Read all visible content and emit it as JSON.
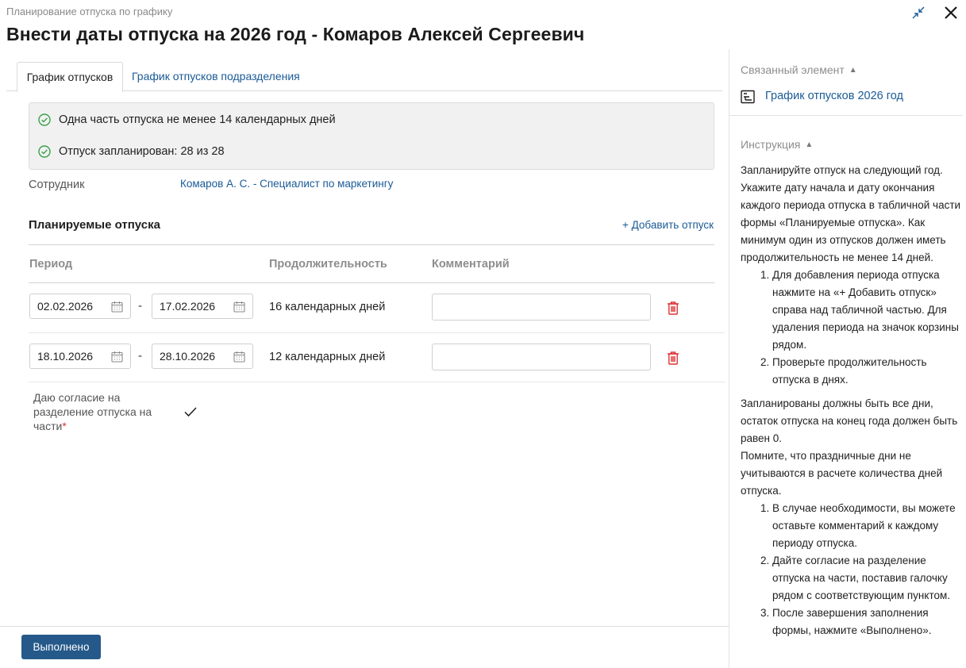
{
  "header": {
    "breadcrumb": "Планирование отпуска по графику",
    "title": "Внести даты отпуска на 2026 год - Комаров Алексей Сергеевич"
  },
  "tabs": [
    {
      "label": "График отпусков",
      "active": true
    },
    {
      "label": "График отпусков подразделения",
      "active": false
    }
  ],
  "checks": [
    {
      "text": "Одна часть отпуска не менее 14 календарных дней",
      "status": "ok"
    },
    {
      "text": "Отпуск запланирован: 28 из 28",
      "status": "ok"
    }
  ],
  "employee": {
    "label": "Сотрудник",
    "value": "Комаров А. С. - Специалист по маркетингу"
  },
  "vacations": {
    "title": "Планируемые отпуска",
    "add_label": "+ Добавить отпуск",
    "columns": {
      "period": "Период",
      "duration": "Продолжительность",
      "comment": "Комментарий"
    },
    "rows": [
      {
        "start": "02.02.2026",
        "end": "17.02.2026",
        "duration": "16 календарных дней",
        "comment": ""
      },
      {
        "start": "18.10.2026",
        "end": "28.10.2026",
        "duration": "12 календарных дней",
        "comment": ""
      }
    ],
    "dash": "-"
  },
  "consent": {
    "label": "Даю согласие на разделение отпуска на части",
    "required_mark": "*",
    "checked": true
  },
  "footer": {
    "done_label": "Выполнено"
  },
  "sidebar": {
    "related_header": "Связанный элемент",
    "related_link": "График отпусков 2026 год",
    "instruction_header": "Инструкция",
    "instruction": {
      "p1": "Запланируйте отпуск на следующий год. Укажите дату начала и дату окончания каждого периода отпуска в табличной части формы «Планируемые отпуска». Как минимум один из отпусков должен иметь продолжительность не менее 14 дней.",
      "list1": [
        "Для добавления периода отпуска нажмите на «+ Добавить отпуск» справа над табличной частью. Для удаления периода на значок корзины рядом.",
        "Проверьте продолжительность отпуска в днях."
      ],
      "p2": "Запланированы должны быть все дни, остаток отпуска на конец года должен быть равен 0.",
      "p3": "Помните, что праздничные дни не учитываются в расчете количества дней отпуска.",
      "list2": [
        "В случае необходимости, вы можете оставьте комментарий к каждому периоду отпуска.",
        "Дайте согласие на разделение отпуска на части, поставив галочку рядом с соответствующим пунктом.",
        "После завершения заполнения формы, нажмите «Выполнено»."
      ]
    }
  },
  "colors": {
    "link": "#1a5a96",
    "primary_button": "#25598a",
    "ok": "#3aa04a",
    "danger": "#d33"
  }
}
